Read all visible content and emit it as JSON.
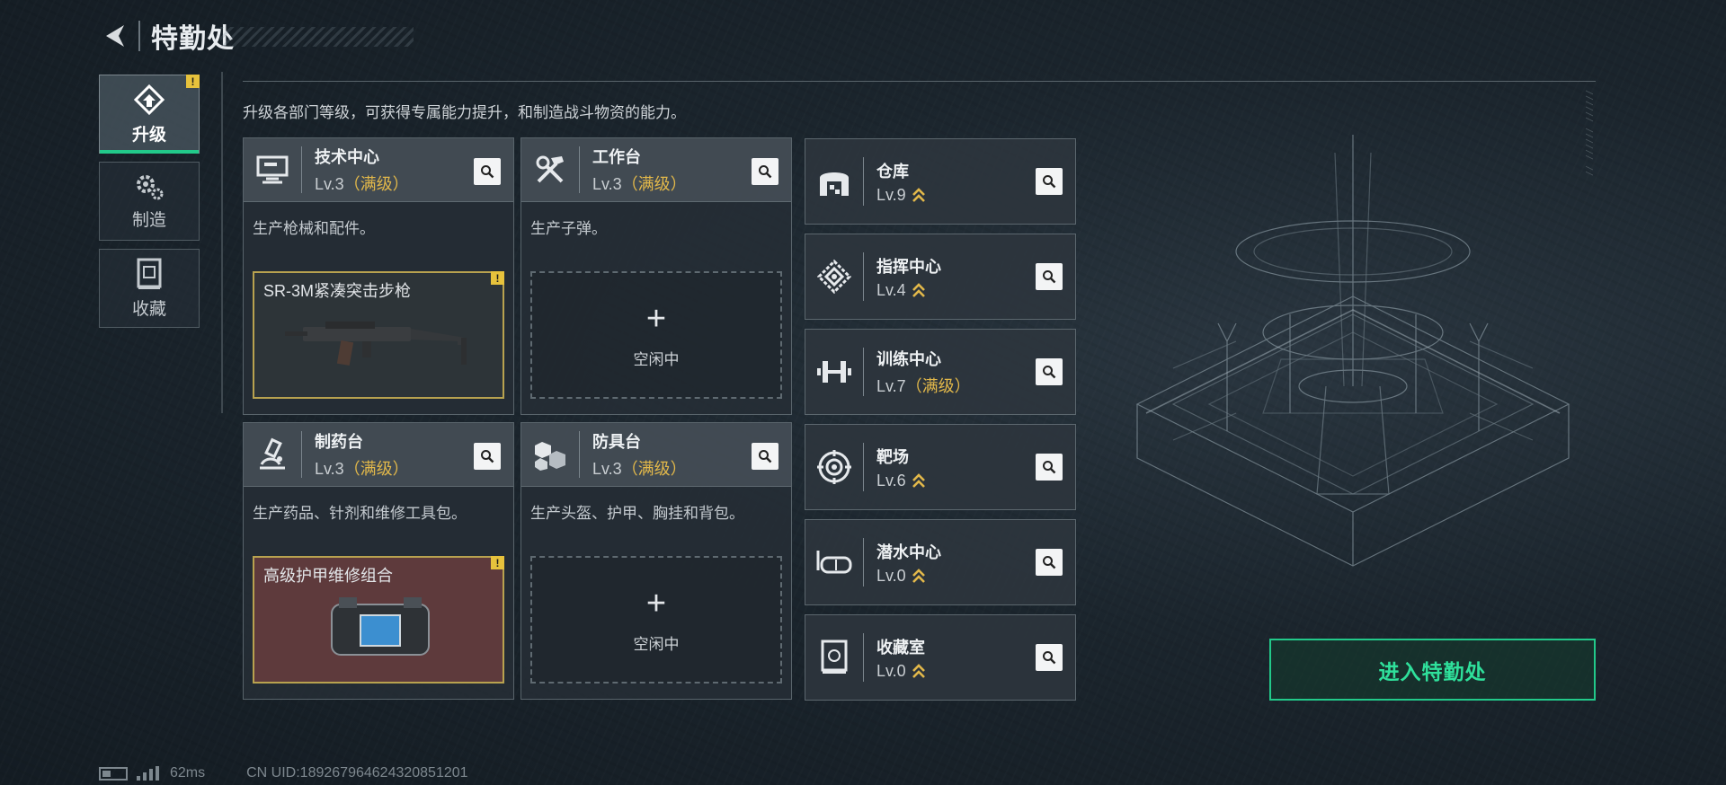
{
  "header": {
    "title": "特勤处"
  },
  "subtitle": "升级各部门等级，可获得专属能力提升，和制造战斗物资的能力。",
  "sidebar": [
    {
      "label": "升级",
      "icon": "upgrade-icon",
      "active": true,
      "alert": "!"
    },
    {
      "label": "制造",
      "icon": "gears-icon"
    },
    {
      "label": "收藏",
      "icon": "collection-icon"
    }
  ],
  "workshops": [
    {
      "name": "技术中心",
      "level": "Lv.3",
      "max": "（满级）",
      "icon": "computer-icon",
      "desc": "生产枪械和配件。",
      "slot": {
        "item": "SR-3M紧凑突击步枪",
        "alert": "!"
      }
    },
    {
      "name": "工作台",
      "level": "Lv.3",
      "max": "（满级）",
      "icon": "tools-icon",
      "desc": "生产子弹。",
      "slot": {
        "plus": "+",
        "idle": "空闲中"
      }
    },
    {
      "name": "制药台",
      "level": "Lv.3",
      "max": "（满级）",
      "icon": "microscope-icon",
      "desc": "生产药品、针剂和维修工具包。",
      "slot": {
        "item": "高级护甲维修组合",
        "alert": "!"
      }
    },
    {
      "name": "防具台",
      "level": "Lv.3",
      "max": "（满级）",
      "icon": "cubes-icon",
      "desc": "生产头盔、护甲、胸挂和背包。",
      "slot": {
        "plus": "+",
        "idle": "空闲中"
      }
    }
  ],
  "facilities": [
    {
      "name": "仓库",
      "level": "Lv.9",
      "icon": "warehouse-icon"
    },
    {
      "name": "指挥中心",
      "level": "Lv.4",
      "icon": "command-icon"
    },
    {
      "name": "训练中心",
      "level": "Lv.7",
      "max": "（满级）",
      "icon": "dumbbell-icon"
    },
    {
      "name": "靶场",
      "level": "Lv.6",
      "icon": "target-icon"
    },
    {
      "name": "潜水中心",
      "level": "Lv.0",
      "icon": "goggles-icon"
    },
    {
      "name": "收藏室",
      "level": "Lv.0",
      "icon": "vault-icon"
    }
  ],
  "enter_button": "进入特勤处",
  "status": {
    "ping": "62ms",
    "uid": "CN UID:1892679646243208512​01"
  },
  "colors": {
    "accent": "#22c98a",
    "max_level": "#e2b84a",
    "alert": "#e7c23c"
  }
}
